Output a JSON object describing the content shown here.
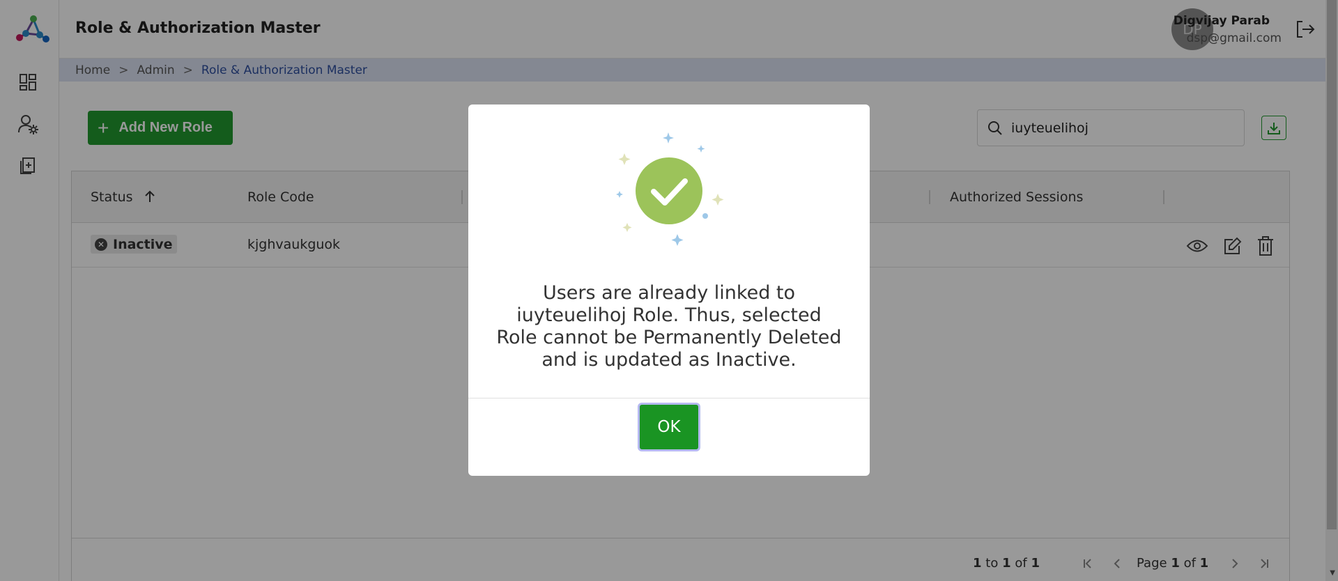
{
  "header": {
    "title": "Role & Authorization Master",
    "user": {
      "initials": "DP",
      "name": "Digvijay Parab",
      "email": "dsp@gmail.com"
    }
  },
  "sidebar": {
    "items": [
      {
        "icon": "dashboard-icon"
      },
      {
        "icon": "user-settings-icon"
      },
      {
        "icon": "add-document-icon"
      }
    ]
  },
  "breadcrumb": {
    "items": [
      "Home",
      "Admin",
      "Role & Authorization Master"
    ],
    "separator": ">"
  },
  "toolbar": {
    "add_label": "Add New Role",
    "search_value": "iuyteuelihoj"
  },
  "table": {
    "columns": [
      "Status",
      "Role Code",
      "Authorized Sessions"
    ],
    "rows": [
      {
        "status": "Inactive",
        "role_code": "kjghvaukguok"
      }
    ],
    "footer": {
      "from": "1",
      "to_word": "to",
      "to": "1",
      "of_word": "of",
      "total": "1",
      "page_word": "Page",
      "page": "1",
      "page_of_word": "of",
      "pages": "1"
    }
  },
  "modal": {
    "message": "Users are already linked to iuyteuelihoj Role. Thus, selected Role cannot be Permanently Deleted and is updated as Inactive.",
    "ok_label": "OK"
  },
  "colors": {
    "primary_green": "#229a30",
    "success_check": "#9cc35a",
    "link_blue": "#2e4fa0"
  }
}
